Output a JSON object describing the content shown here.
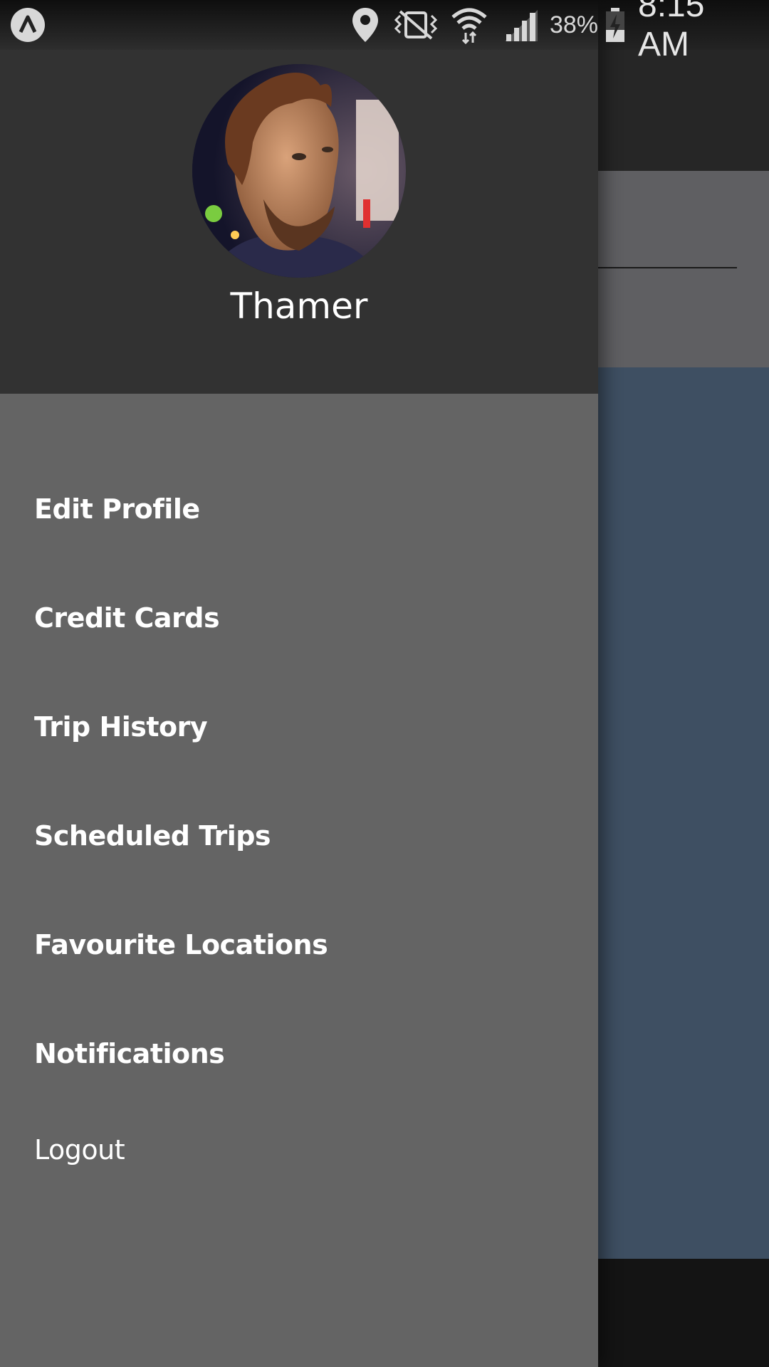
{
  "status_bar": {
    "notification_icon": "app-notification-icon",
    "icons": [
      "location-icon",
      "vibrate-icon",
      "wifi-icon",
      "signal-icon",
      "battery-charging-icon"
    ],
    "battery": "38%",
    "time": "8:15 AM"
  },
  "drawer": {
    "user_name": "Thamer",
    "avatar": "profile-photo",
    "menu": [
      {
        "label": "Edit Profile"
      },
      {
        "label": "Credit Cards"
      },
      {
        "label": "Trip History"
      },
      {
        "label": "Scheduled Trips"
      },
      {
        "label": "Favourite Locations"
      },
      {
        "label": "Notifications"
      },
      {
        "label": "Logout"
      }
    ]
  },
  "colors": {
    "drawer_header": "#323232",
    "drawer_body": "#646464",
    "menu_text": "#ffffff",
    "background_map": "#3e4f62"
  }
}
